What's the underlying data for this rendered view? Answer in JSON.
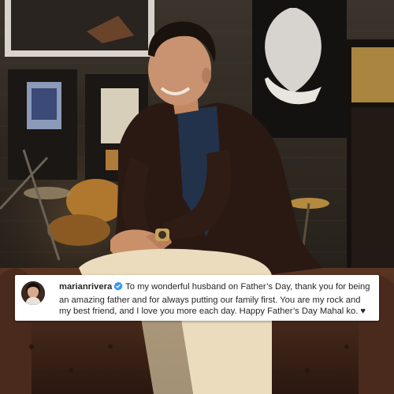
{
  "post": {
    "username": "marianrivera",
    "verified": true,
    "caption": "To my wonderful husband on Father’s Day, thank you for being an amazing father and for always putting our family first. You are my rock and my best friend, and I love you more each day. Happy Father’s Day Mahal ko. ♥"
  },
  "colors": {
    "wall": "#2b2620",
    "sofa": "#4a2a1c",
    "jacket": "#2c1a14",
    "shirt": "#23324a",
    "pants": "#e9dcbf",
    "verified_badge": "#3897f0"
  },
  "icons": {
    "verified": "verified-badge-icon",
    "heart": "heart-icon"
  }
}
